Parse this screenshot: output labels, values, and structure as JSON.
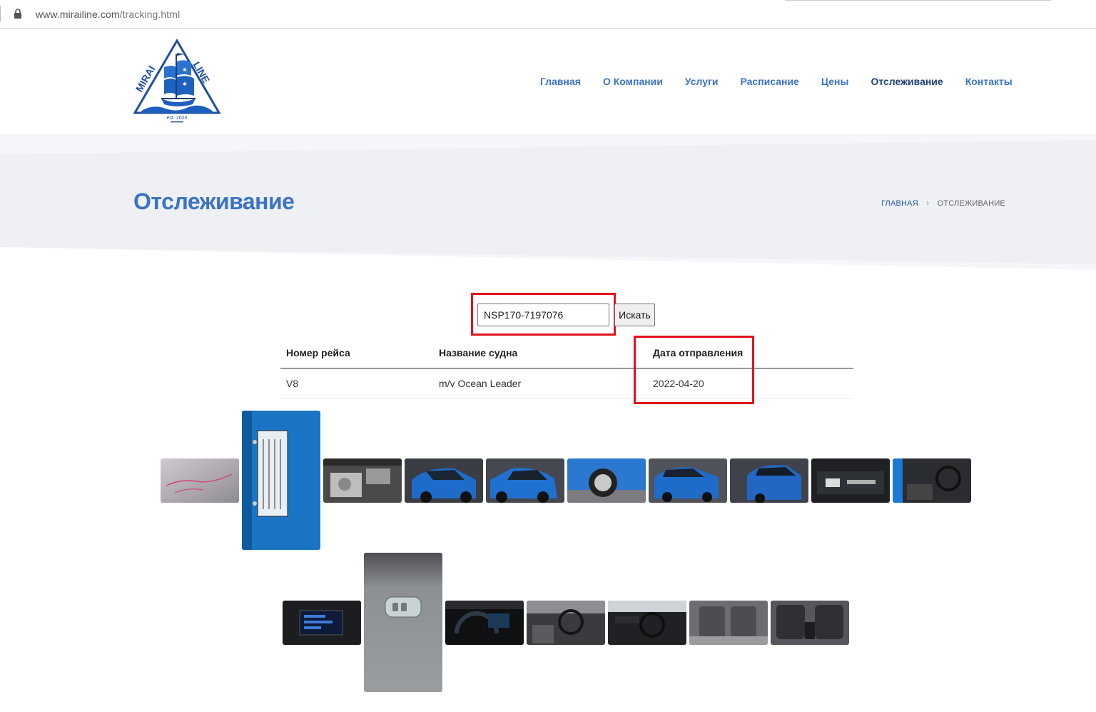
{
  "browser": {
    "url_domain": "www.mirailine.com",
    "url_path": "/tracking.html"
  },
  "logo": {
    "top_text_left": "MIRAI",
    "top_text_right": "LINE",
    "est": "est. 2020"
  },
  "nav": {
    "items": [
      {
        "label": "Главная"
      },
      {
        "label": "О Компании"
      },
      {
        "label": "Услуги"
      },
      {
        "label": "Расписание"
      },
      {
        "label": "Цены"
      },
      {
        "label": "Отслеживание",
        "active": true
      },
      {
        "label": "Контакты"
      }
    ]
  },
  "banner": {
    "title": "Отслеживание",
    "breadcrumb": {
      "home": "ГЛАВНАЯ",
      "current": "ОТСЛЕЖИВАНИЕ"
    }
  },
  "search": {
    "value": "NSP170-7197076",
    "button_label": "Искать"
  },
  "table": {
    "headers": [
      "Номер рейса",
      "Название судна",
      "Дата отправления"
    ],
    "rows": [
      [
        "V8",
        "m/v Ocean Leader",
        "2022-04-20"
      ]
    ]
  },
  "photos": {
    "row1": [
      "chassis-number-photo",
      "vin-plate-photo",
      "engine-photo",
      "front-left-photo",
      "front-right-photo",
      "wheel-photo",
      "rear-left-photo",
      "rear-right-photo",
      "trunk-photo",
      "driver-seat-photo"
    ],
    "row2": [
      "navigation-screen-photo",
      "smart-key-photo",
      "instrument-cluster-photo",
      "dashboard-left-photo",
      "dashboard-photo",
      "rear-seats-photo",
      "front-seats-photo"
    ]
  },
  "colors": {
    "brand_blue": "#3b73c5",
    "nav_active": "#1d3f73",
    "banner_bg": "#eef0f4",
    "highlight_red": "#e0131c"
  }
}
